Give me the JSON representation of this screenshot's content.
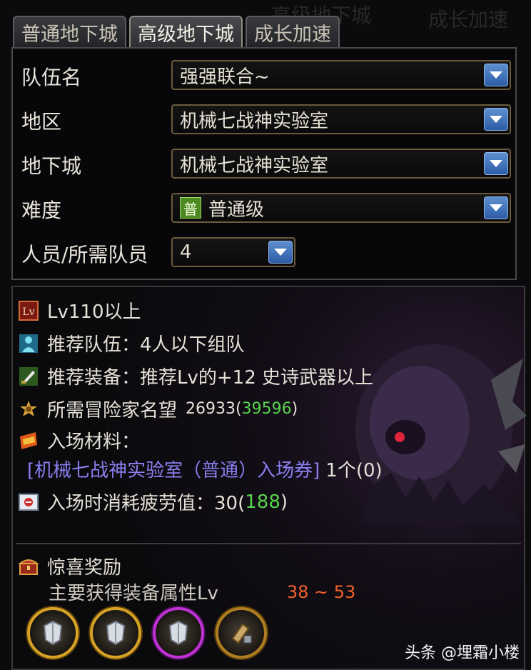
{
  "tabs": [
    {
      "label": "普通地下城",
      "active": false
    },
    {
      "label": "高级地下城",
      "active": true
    },
    {
      "label": "成长加速",
      "active": false
    }
  ],
  "form": {
    "team_name_label": "队伍名",
    "team_name_value": "强强联合~",
    "region_label": "地区",
    "region_value": "机械七战神实验室",
    "dungeon_label": "地下城",
    "dungeon_value": "机械七战神实验室",
    "difficulty_label": "难度",
    "difficulty_badge": "普",
    "difficulty_value": "普通级",
    "members_label": "人员/所需队员",
    "members_value": "4"
  },
  "info": {
    "level_icon_text": "Lv",
    "level_text": "Lv110以上",
    "team_text": "推荐队伍：4人以下组队",
    "gear_text": "推荐装备：推荐Lv的+12 史诗武器以上",
    "fame_label": "所需冒险家名望",
    "fame_current": "26933(",
    "fame_required": "39596",
    "fame_close": ")",
    "material_label": "入场材料：",
    "ticket_name": "[机械七战神实验室（普通）入场券]",
    "ticket_count": "1个(0)",
    "fatigue_label": "入场时消耗疲劳值：30(",
    "fatigue_value": "188",
    "fatigue_close": ")",
    "reward_title": "惊喜奖励",
    "reward_lv_label": "主要获得装备属性Lv",
    "reward_lv_range": "38 ~ 53"
  },
  "watermark": {
    "text": "头条 @埋霜小楼"
  },
  "colors": {
    "accent_green": "#58d34f",
    "ticket_purple": "#8a7ff0",
    "range_orange": "#f0612a",
    "dropdown_blue": "#3d6fb8"
  }
}
